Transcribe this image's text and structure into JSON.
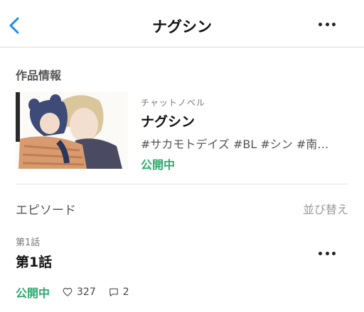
{
  "nav": {
    "title": "ナグシン",
    "back_icon": "chevron-left-icon",
    "more_icon": "more-horizontal-icon",
    "accent_color": "#1a8cf0"
  },
  "work_info": {
    "section_title": "作品情報",
    "genre": "チャットノベル",
    "title": "ナグシン",
    "tags": "#サカモトデイズ #BL #シン #南…",
    "status": "公開中",
    "status_color": "#2daa6c"
  },
  "episodes": {
    "header": "エピソード",
    "sort_label": "並び替え",
    "items": [
      {
        "number_label": "第1話",
        "title": "第1話",
        "status": "公開中",
        "likes": "327",
        "comments": "2"
      }
    ]
  }
}
